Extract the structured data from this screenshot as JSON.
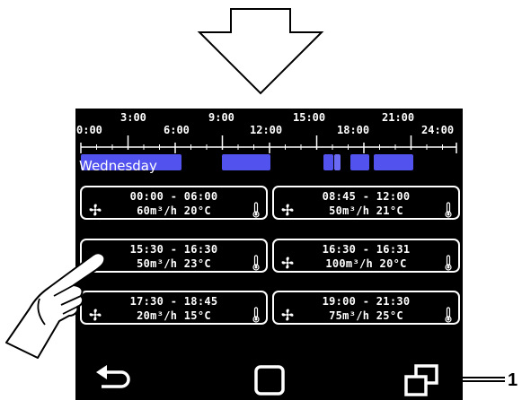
{
  "timeline": {
    "ticks_top": [
      "3:00",
      "9:00",
      "15:00",
      "21:00"
    ],
    "ticks_bottom": [
      "0:00",
      "6:00",
      "12:00",
      "18:00",
      "24:00"
    ],
    "day": "Wednesday",
    "active_color": "#5252ee"
  },
  "schedule": [
    {
      "time": "00:00 - 06:00",
      "values": "60m³/h 20°C"
    },
    {
      "time": "08:45 - 12:00",
      "values": "50m³/h 21°C"
    },
    {
      "time": "15:30 - 16:30",
      "values": "50m³/h 23°C"
    },
    {
      "time": "16:30 - 16:31",
      "values": "100m³/h 20°C"
    },
    {
      "time": "17:30 - 18:45",
      "values": "20m³/h 15°C"
    },
    {
      "time": "19:00 - 21:30",
      "values": "75m³/h 25°C"
    }
  ],
  "icons": {
    "card_left": "fan-icon",
    "card_right": "thermometer-icon",
    "nav": [
      "back-arrow-icon",
      "home-square-icon",
      "copy-windows-icon"
    ]
  },
  "callout": {
    "label": "1"
  }
}
